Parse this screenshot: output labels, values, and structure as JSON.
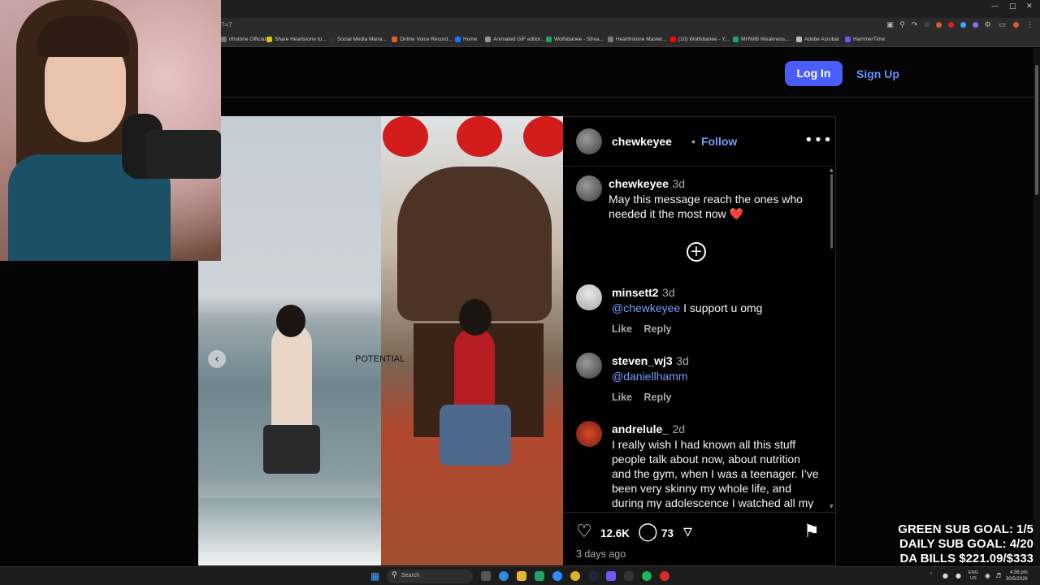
{
  "browser": {
    "url_fragment": "?=7",
    "bookmarks": [
      {
        "label": "rthstone Official...",
        "color": "#777777"
      },
      {
        "label": "Share Heartstone to...",
        "color": "#e0c020"
      },
      {
        "label": "Social Media Mana...",
        "color": "#333333"
      },
      {
        "label": "Online Voice Record...",
        "color": "#e35b2c"
      },
      {
        "label": "Home",
        "color": "#1877f2"
      },
      {
        "label": "Animated GIF editor...",
        "color": "#999999"
      },
      {
        "label": "Wolfsbanee - Strea...",
        "color": "#1fa463"
      },
      {
        "label": "Hearthstone Master...",
        "color": "#777777"
      },
      {
        "label": "(10) Wolfsbanee - Y...",
        "color": "#ff0000"
      },
      {
        "label": "MHWiB Weakness...",
        "color": "#1fa463"
      },
      {
        "label": "Adobe Acrobat",
        "color": "#bbbbbb"
      },
      {
        "label": "HammerTime",
        "color": "#6a5af9"
      }
    ]
  },
  "site_header": {
    "login_label": "Log In",
    "signup_label": "Sign Up"
  },
  "post": {
    "overlay_text": "POTENTIAL",
    "author": "chewkeyee",
    "follow_label": "Follow",
    "caption": {
      "user": "chewkeyee",
      "time": "3d",
      "text": "May this message reach the ones who needed it the most now ❤️"
    },
    "comments": [
      {
        "user": "minsett2",
        "time": "3d",
        "mention": "@chewkeyee",
        "text": " I support u omg",
        "like": "Like",
        "reply": "Reply"
      },
      {
        "user": "steven_wj3",
        "time": "3d",
        "mention": "@daniellhamm",
        "text": "",
        "like": "Like",
        "reply": "Reply"
      },
      {
        "user": "andrelule_",
        "time": "2d",
        "mention": "",
        "text": "I really wish I had known all this stuff people talk about now, about nutrition and the gym, when I was a teenager. I’ve been very skinny my whole life, and during my adolescence I watched all my"
      }
    ],
    "likes": "12.6K",
    "comment_count": "73",
    "posted": "3 days ago"
  },
  "stream_overlay": {
    "goals": [
      "GREEN SUB GOAL: 1/5",
      "DAILY SUB GOAL: 4/20",
      "DA BILLS $221.09/$333"
    ]
  },
  "taskbar": {
    "search_label": "Search",
    "lang_top": "ENG",
    "lang_bottom": "US",
    "time": "4:36 pm",
    "date": "30/5/2026"
  },
  "colors": {
    "accent": "#4a5df9",
    "link": "#7c9bff",
    "heart": "#e0483a"
  },
  "icons": {
    "like": "heart-outline-icon",
    "comment": "speech-bubble-icon",
    "share": "paper-plane-icon",
    "save": "bookmark-icon",
    "add": "plus-circle-icon",
    "more": "more-horizontal-icon"
  }
}
